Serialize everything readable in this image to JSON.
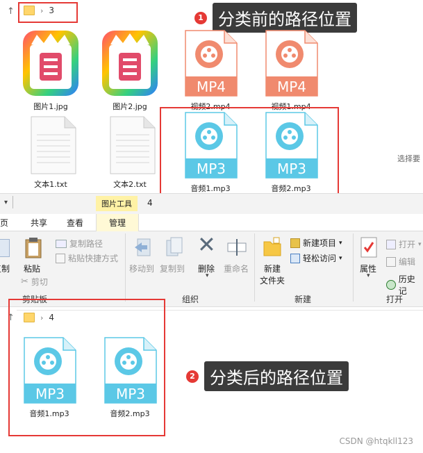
{
  "top_explorer": {
    "address": "3",
    "files": [
      {
        "name": "图片1.jpg",
        "type": "image"
      },
      {
        "name": "图片2.jpg",
        "type": "image"
      },
      {
        "name": "视频2.mp4",
        "type": "mp4",
        "badge": "MP4"
      },
      {
        "name": "视频1.mp4",
        "type": "mp4",
        "badge": "MP4"
      },
      {
        "name": "文本1.txt",
        "type": "txt"
      },
      {
        "name": "文本2.txt",
        "type": "txt"
      },
      {
        "name": "音频1.mp3",
        "type": "mp3",
        "badge": "MP3"
      },
      {
        "name": "音频2.mp3",
        "type": "mp3",
        "badge": "MP3"
      }
    ],
    "side_hint": "选择要"
  },
  "annotations": {
    "before_num": "1",
    "before_text": "分类前的路径位置",
    "after_num": "2",
    "after_text": "分类后的路径位置"
  },
  "ribbon": {
    "context_tab": "图片工具",
    "title_number": "4",
    "tabs": {
      "home": "主页",
      "share": "共享",
      "view": "查看",
      "manage": "管理"
    },
    "clipboard": {
      "copy": "复制",
      "paste": "粘贴",
      "copy_path": "复制路径",
      "paste_shortcut": "粘贴快捷方式",
      "cut": "剪切",
      "group": "剪贴板"
    },
    "organize": {
      "move_to": "移动到",
      "copy_to": "复制到",
      "delete": "删除",
      "rename": "重命名",
      "group": "组织"
    },
    "new": {
      "new_folder": "新建",
      "new_folder2": "文件夹",
      "new_item": "新建项目",
      "easy_access": "轻松访问",
      "group": "新建"
    },
    "open": {
      "properties": "属性",
      "open": "打开",
      "edit": "编辑",
      "history": "历史记",
      "group": "打开"
    }
  },
  "bottom_explorer": {
    "address": "4",
    "files": [
      {
        "name": "音频1.mp3",
        "badge": "MP3"
      },
      {
        "name": "音频2.mp3",
        "badge": "MP3"
      }
    ]
  },
  "watermark": "CSDN @htqkll123",
  "colors": {
    "mp3": "#5bc8e6",
    "mp4": "#f08a6e",
    "accent_red": "#e53935"
  }
}
